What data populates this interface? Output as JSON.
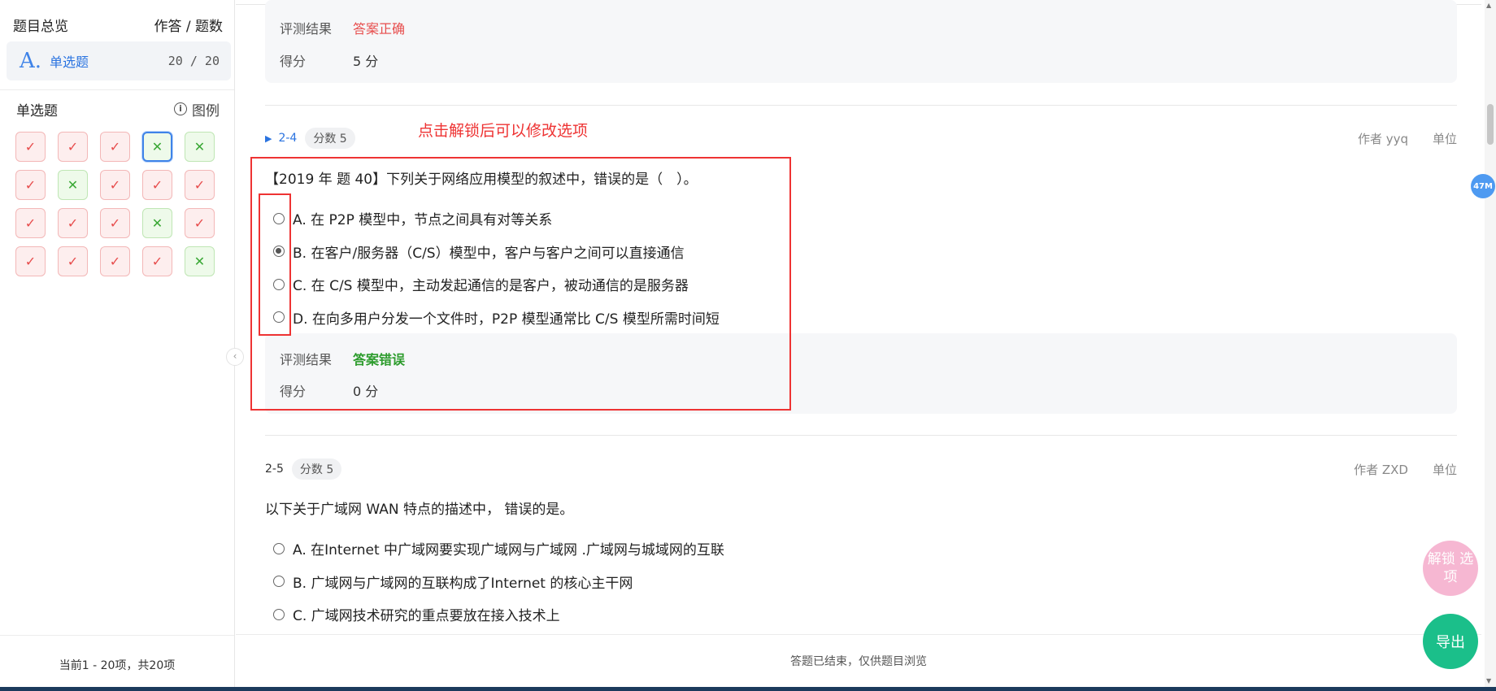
{
  "sidebar": {
    "overview_title": "题目总览",
    "overview_right": "作答 / 题数",
    "type": {
      "icon": "A.",
      "label": "单选题",
      "count": "20 / 20"
    },
    "section_title": "单选题",
    "legend_label": "图例",
    "grid": [
      {
        "status": "correct",
        "mark": "✓"
      },
      {
        "status": "correct",
        "mark": "✓"
      },
      {
        "status": "correct",
        "mark": "✓"
      },
      {
        "status": "wrong",
        "mark": "✕",
        "current": true
      },
      {
        "status": "wrong",
        "mark": "✕"
      },
      {
        "status": "correct",
        "mark": "✓"
      },
      {
        "status": "wrong",
        "mark": "✕"
      },
      {
        "status": "correct",
        "mark": "✓"
      },
      {
        "status": "correct",
        "mark": "✓"
      },
      {
        "status": "correct",
        "mark": "✓"
      },
      {
        "status": "correct",
        "mark": "✓"
      },
      {
        "status": "correct",
        "mark": "✓"
      },
      {
        "status": "correct",
        "mark": "✓"
      },
      {
        "status": "wrong",
        "mark": "✕"
      },
      {
        "status": "correct",
        "mark": "✓"
      },
      {
        "status": "correct",
        "mark": "✓"
      },
      {
        "status": "correct",
        "mark": "✓"
      },
      {
        "status": "correct",
        "mark": "✓"
      },
      {
        "status": "correct",
        "mark": "✓"
      },
      {
        "status": "wrong",
        "mark": "✕"
      }
    ],
    "footer": "当前1 - 20项，共20项"
  },
  "prev": {
    "result_label": "评测结果",
    "result_value": "答案正确",
    "score_label": "得分",
    "score_value": "5 分"
  },
  "annotation": "点击解锁后可以修改选项",
  "q4": {
    "number": "2-4",
    "score": "分数 5",
    "author": "作者 yyq",
    "unit": "单位",
    "text": "【2019 年 题 40】下列关于网络应用模型的叙述中，错误的是（　）。",
    "options": [
      {
        "label": "A.  在 P2P 模型中，节点之间具有对等关系",
        "selected": false
      },
      {
        "label": "B.  在客户/服务器（C/S）模型中，客户与客户之间可以直接通信",
        "selected": true
      },
      {
        "label": "C.  在 C/S 模型中，主动发起通信的是客户，被动通信的是服务器",
        "selected": false
      },
      {
        "label": "D.  在向多用户分发一个文件时，P2P 模型通常比 C/S 模型所需时间短",
        "selected": false
      }
    ],
    "result_label": "评测结果",
    "result_value": "答案错误",
    "score_label": "得分",
    "score_value": "0 分"
  },
  "q5": {
    "number": "2-5",
    "score": "分数 5",
    "author": "作者 ZXD",
    "unit": "单位",
    "text": "以下关于广域网 WAN 特点的描述中， 错误的是。",
    "options": [
      {
        "label": "A.  在Internet 中广域网要实现广域网与广域网 .广域网与城域网的互联",
        "selected": false
      },
      {
        "label": "B.  广域网与广域网的互联构成了Internet 的核心主干网",
        "selected": false
      },
      {
        "label": "C.  广域网技术研究的重点要放在接入技术上",
        "selected": false
      }
    ]
  },
  "bottom_status": "答题已结束，仅供题目浏览",
  "floating": {
    "memory": "47M",
    "unlock": "解锁 选项",
    "export": "导出"
  },
  "colors": {
    "accent": "#2a73e0",
    "correct_cell": "#e74c4c",
    "wrong_cell": "#3aa835",
    "annotation": "#e33333",
    "export": "#1bbf8a",
    "unlock": "#f6b7d2"
  }
}
